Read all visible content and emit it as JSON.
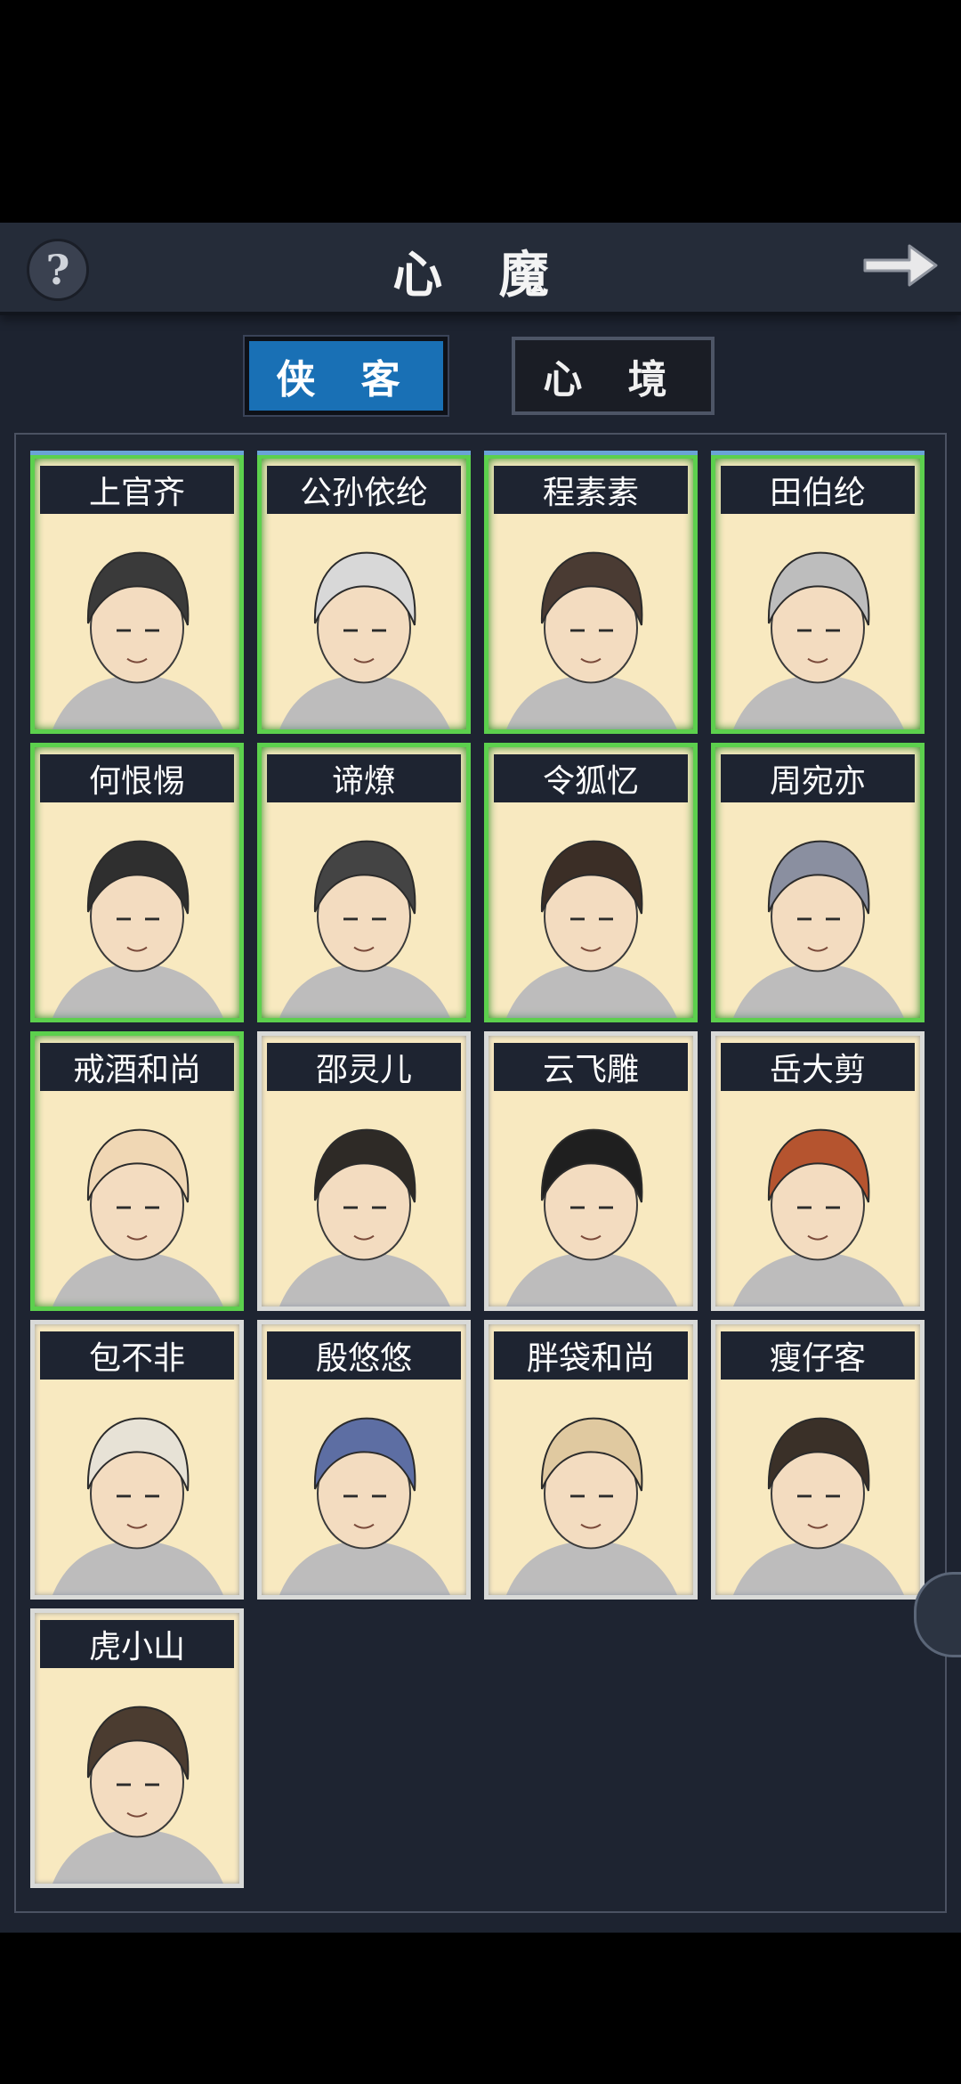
{
  "header": {
    "title": "心 魔",
    "help_icon": "help-icon",
    "next_icon": "arrow-right-icon"
  },
  "tabs": [
    {
      "label": "侠 客",
      "active": true
    },
    {
      "label": "心 境",
      "active": false
    }
  ],
  "colors": {
    "active_tab": "#1970b5",
    "unlocked_border": "#5cd04d",
    "locked_border": "#d9dad8",
    "card_bg": "#f8e9c0"
  },
  "characters": [
    {
      "name": "上官齐",
      "unlocked": true
    },
    {
      "name": "公孙依纶",
      "unlocked": true
    },
    {
      "name": "程素素",
      "unlocked": true
    },
    {
      "name": "田伯纶",
      "unlocked": true
    },
    {
      "name": "何恨惕",
      "unlocked": true
    },
    {
      "name": "谛燎",
      "unlocked": true
    },
    {
      "name": "令狐忆",
      "unlocked": true
    },
    {
      "name": "周宛亦",
      "unlocked": true
    },
    {
      "name": "戒酒和尚",
      "unlocked": true
    },
    {
      "name": "邵灵儿",
      "unlocked": false
    },
    {
      "name": "云飞雕",
      "unlocked": false
    },
    {
      "name": "岳大剪",
      "unlocked": false
    },
    {
      "name": "包不非",
      "unlocked": false
    },
    {
      "name": "殷悠悠",
      "unlocked": false
    },
    {
      "name": "胖袋和尚",
      "unlocked": false
    },
    {
      "name": "瘦仔客",
      "unlocked": false
    },
    {
      "name": "虎小山",
      "unlocked": false
    }
  ]
}
